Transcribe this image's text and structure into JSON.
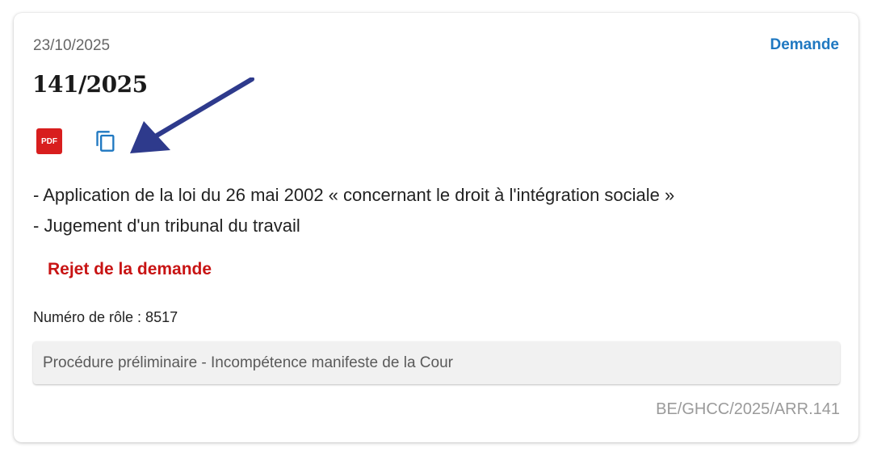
{
  "card": {
    "date": "23/10/2025",
    "type_label": "Demande",
    "title": "141/2025",
    "pdf_label": "PDF",
    "summary": [
      "- Application de la loi du 26 mai 2002 « concernant le droit à l'intégration sociale »",
      "- Jugement d'un tribunal du travail"
    ],
    "decision": "Rejet de la demande",
    "role_number": "Numéro de rôle : 8517",
    "procedure": "Procédure préliminaire - Incompétence manifeste de la Cour",
    "reference": "BE/GHCC/2025/ARR.141"
  },
  "icons": {
    "pdf": "pdf-icon",
    "copy": "copy-icon",
    "annotation": "arrow-annotation"
  },
  "colors": {
    "link": "#1f78c1",
    "decision": "#c81414",
    "pdf": "#d81e1e",
    "arrow": "#2e3a8c"
  }
}
